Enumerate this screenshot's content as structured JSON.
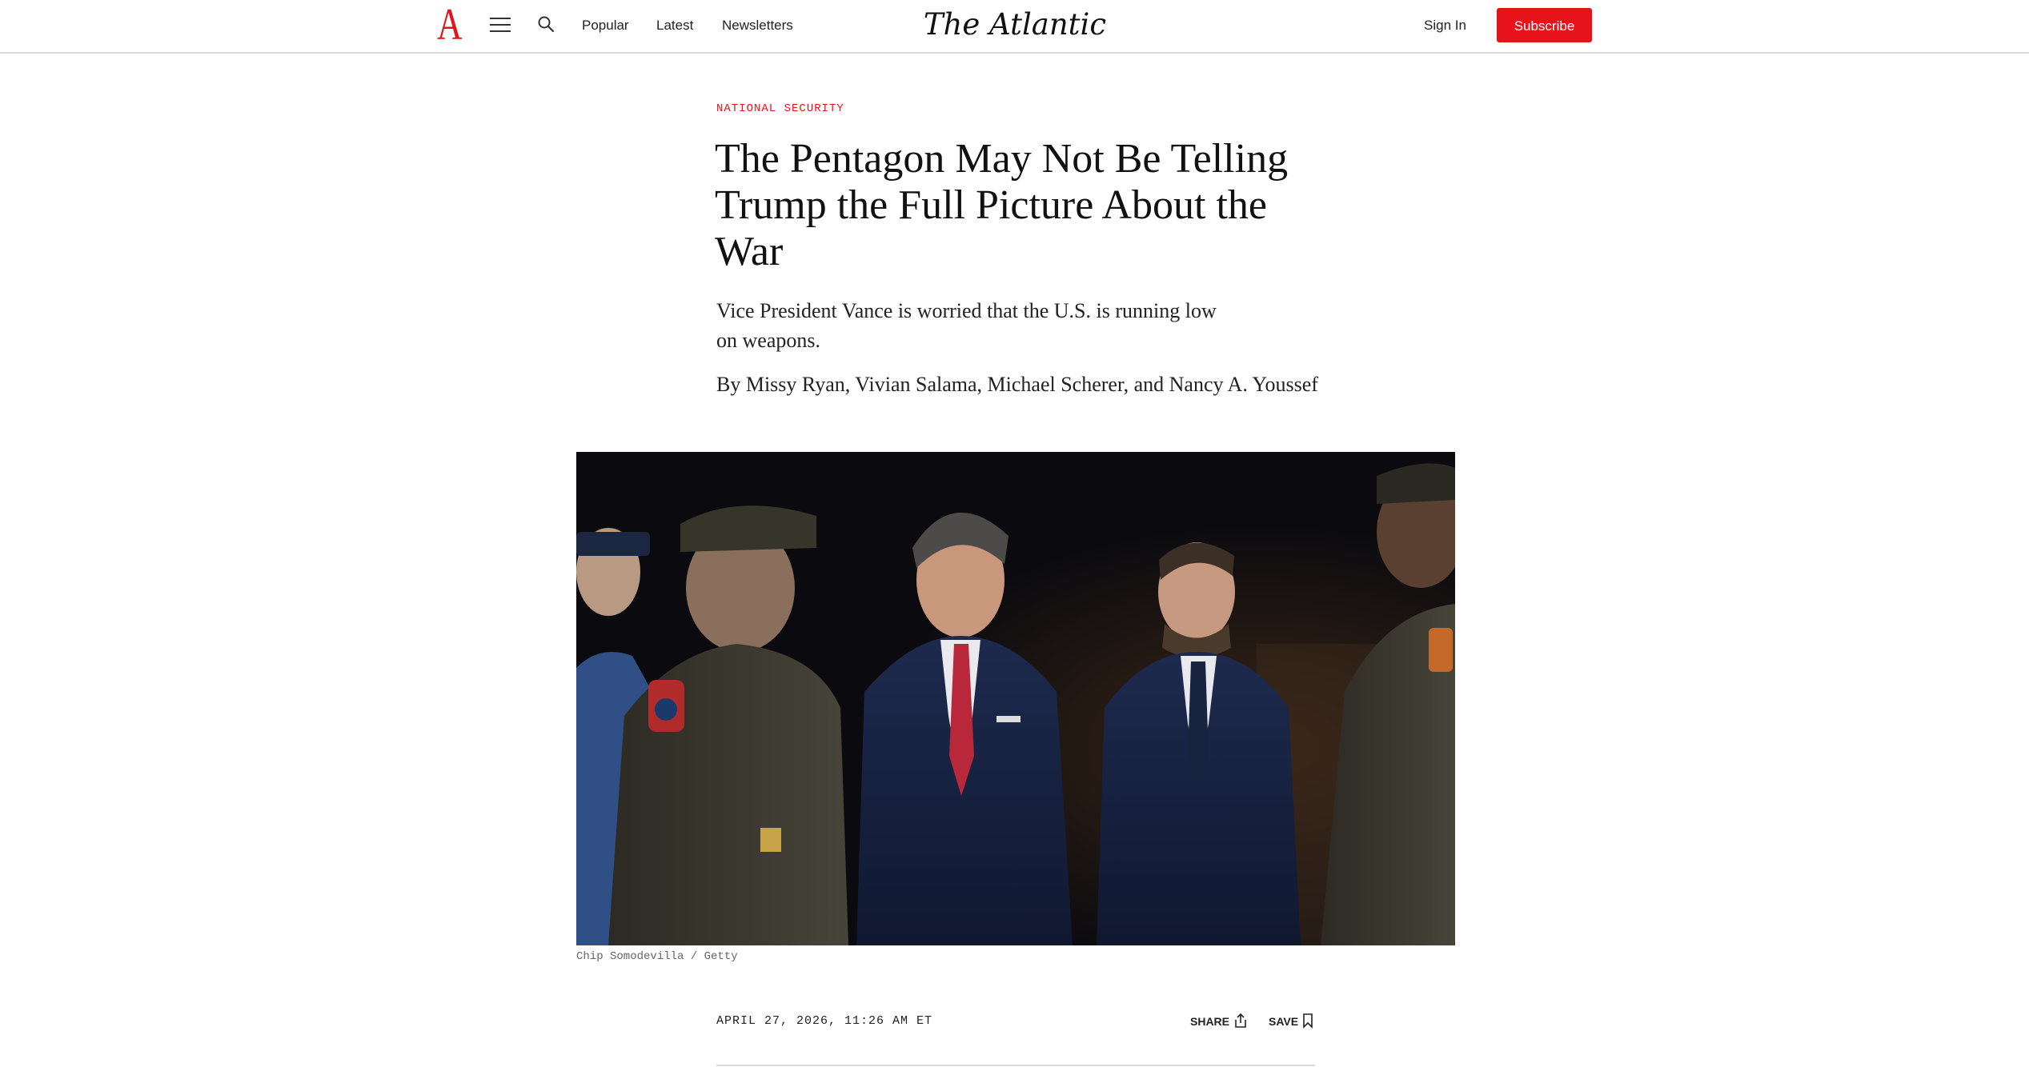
{
  "header": {
    "logo_letter": "A",
    "nav": [
      "Popular",
      "Latest",
      "Newsletters"
    ],
    "masthead": "The Atlantic",
    "sign_in": "Sign In",
    "subscribe": "Subscribe",
    "icons": {
      "menu": "hamburger-menu-icon",
      "search": "search-icon"
    },
    "colors": {
      "brand_red": "#e7131a"
    }
  },
  "article": {
    "section": "NATIONAL SECURITY",
    "headline": "The Pentagon May Not Be Telling Trump the Full Picture About the War",
    "dek": "Vice President Vance is worried that the U.S. is running low on weapons.",
    "byline_prefix": "By ",
    "authors": [
      "Missy Ryan",
      "Vivian Salama",
      "Michael Scherer",
      "Nancy A. Youssef"
    ],
    "byline_sep_1": ", ",
    "byline_sep_2": ", ",
    "byline_sep_3": ", and ",
    "image_credit": "Chip Somodevilla / Getty",
    "dateline": "APRIL 27, 2026, 11:26 AM ET",
    "share_label": "SHARE",
    "save_label": "SAVE",
    "icons": {
      "share": "share-icon",
      "save": "bookmark-icon"
    }
  }
}
